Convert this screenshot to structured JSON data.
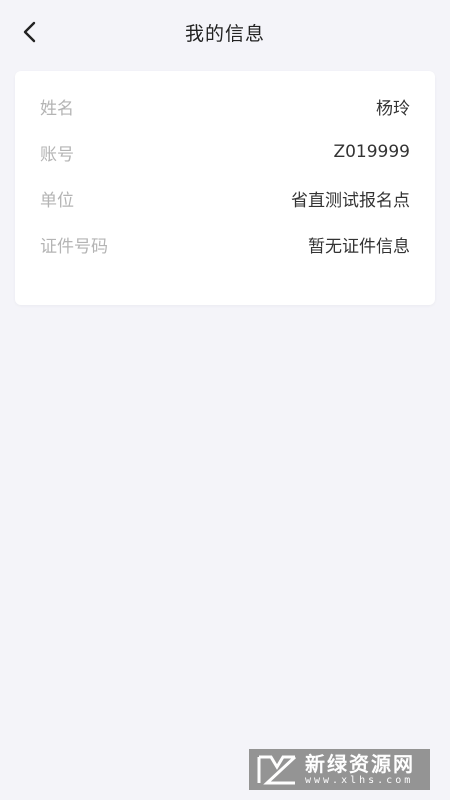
{
  "header": {
    "title": "我的信息"
  },
  "info": {
    "rows": [
      {
        "label": "姓名",
        "value": "杨玲"
      },
      {
        "label": "账号",
        "value": "Z019999"
      },
      {
        "label": "单位",
        "value": "省直测试报名点"
      },
      {
        "label": "证件号码",
        "value": "暂无证件信息"
      }
    ]
  },
  "watermark": {
    "title": "新绿资源网",
    "subtitle": "www.xlhs.com"
  },
  "icons": {
    "back": "chevron-left-icon",
    "watermark_logo": "xl-logo-icon"
  }
}
